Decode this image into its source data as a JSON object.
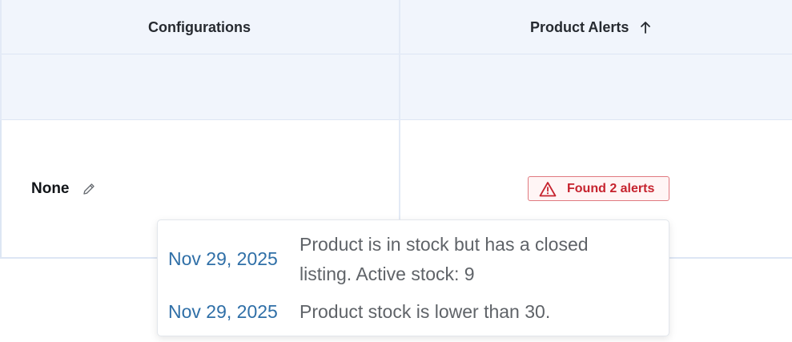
{
  "table": {
    "columns": {
      "configurations": "Configurations",
      "product_alerts": "Product Alerts"
    },
    "row": {
      "configuration_value": "None",
      "alerts_badge": "Found 2 alerts"
    }
  },
  "alerts_popover": {
    "items": [
      {
        "date": "Nov 29, 2025",
        "message": "Product is in stock but has a closed listing. Active stock: 9"
      },
      {
        "date": "Nov 29, 2025",
        "message": "Product stock is lower than 30."
      }
    ]
  },
  "icons": {
    "sort": "arrow-up-icon",
    "edit": "pencil-icon",
    "alert": "warning-triangle-icon"
  },
  "colors": {
    "header_bg": "#f1f5fc",
    "alert_red": "#c6232e",
    "date_blue": "#2f6fa7"
  }
}
